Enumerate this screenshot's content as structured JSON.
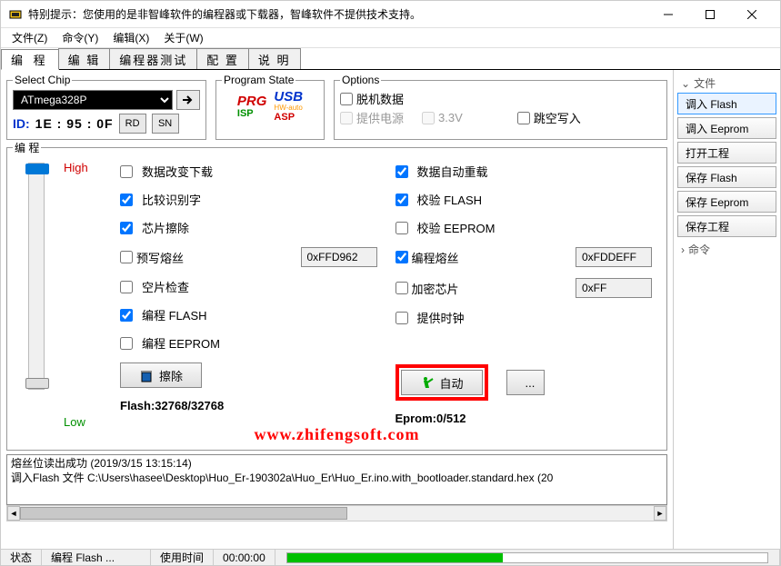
{
  "window": {
    "title": "特别提示：您使用的是非智峰软件的编程器或下载器，智峰软件不提供技术支持。"
  },
  "menubar": [
    "文件(Z)",
    "命令(Y)",
    "编辑(X)",
    "关于(W)"
  ],
  "tabs": [
    "编 程",
    "编 辑",
    "编程器测试",
    "配 置",
    "说 明"
  ],
  "chip": {
    "legend": "Select Chip",
    "value": "ATmega328P",
    "id_label": "ID:",
    "id_value": "1E : 95 : 0F",
    "btn_rd": "RD",
    "btn_sn": "SN"
  },
  "state": {
    "legend": "Program State",
    "prg": "PRG",
    "isp": "ISP",
    "usb": "USB",
    "asp": "ASP",
    "hw": "HW-auto"
  },
  "options": {
    "legend": "Options",
    "offline": "脱机数据",
    "power": "提供电源",
    "v33": "3.3V",
    "skip_blank": "跳空写入"
  },
  "prog": {
    "legend": "编 程",
    "high": "High",
    "low": "Low",
    "left": {
      "data_change_dl": "数据改变下载",
      "compare_id": "比较识别字",
      "chip_erase": "芯片擦除",
      "pre_fuse": "预写熔丝",
      "pre_fuse_hex": "0xFFD962",
      "blank_check": "空片检查",
      "prog_flash": "编程 FLASH",
      "prog_eeprom": "编程 EEPROM",
      "erase_btn": "擦除",
      "flash_stat": "Flash:32768/32768"
    },
    "right": {
      "auto_reload": "数据自动重载",
      "verify_flash": "校验 FLASH",
      "verify_eeprom": "校验 EEPROM",
      "prog_fuse": "编程熔丝",
      "prog_fuse_hex": "0xFDDEFF",
      "encrypt_chip": "加密芯片",
      "encrypt_hex": "0xFF",
      "provide_clock": "提供时钟",
      "auto_btn": "自动",
      "eprom_stat": "Eprom:0/512"
    },
    "watermark": "www.zhifengsoft.com"
  },
  "side": {
    "files_hdr": "文件",
    "cmd_hdr": "命令",
    "buttons": [
      "调入 Flash",
      "调入 Eeprom",
      "打开工程",
      "保存 Flash",
      "保存 Eeprom",
      "保存工程"
    ]
  },
  "log": {
    "line1": "熔丝位读出成功 (2019/3/15 13:15:14)",
    "line2": "调入Flash 文件 C:\\Users\\hasee\\Desktop\\Huo_Er-190302a\\Huo_Er\\Huo_Er.ino.with_bootloader.standard.hex (20"
  },
  "status": {
    "state_lbl": "状态",
    "action": "编程 Flash ...",
    "time_lbl": "使用时间",
    "time_val": "00:00:00"
  }
}
